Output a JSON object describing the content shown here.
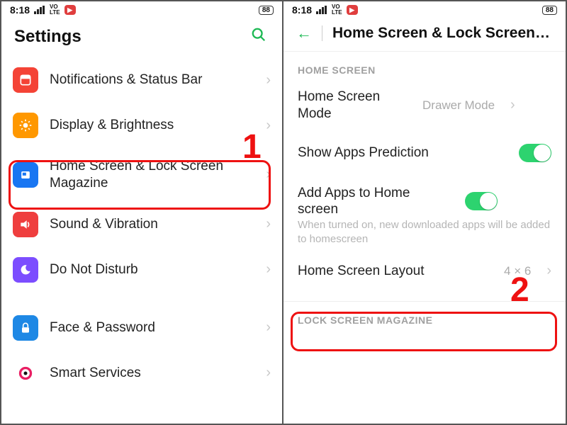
{
  "status": {
    "time": "8:18",
    "volte": "VO\nLTE",
    "battery": "88"
  },
  "left": {
    "title": "Settings",
    "items": [
      {
        "label": "Notifications & Status Bar"
      },
      {
        "label": "Display & Brightness"
      },
      {
        "label": "Home Screen & Lock Screen Magazine"
      },
      {
        "label": "Sound & Vibration"
      },
      {
        "label": "Do Not Disturb"
      },
      {
        "label": "Face & Password"
      },
      {
        "label": "Smart Services"
      }
    ]
  },
  "right": {
    "title": "Home Screen & Lock Screen…",
    "section1": "HOME SCREEN",
    "rows": {
      "mode_label": "Home Screen Mode",
      "mode_value": "Drawer Mode",
      "show_pred": "Show Apps Prediction",
      "add_apps": "Add Apps to Home screen",
      "add_apps_sub": "When turned on, new downloaded apps will be added to homescreen",
      "layout_label": "Home Screen Layout",
      "layout_value": "4 × 6"
    },
    "section2": "LOCK SCREEN MAGAZINE"
  },
  "callouts": {
    "one": "1",
    "two": "2"
  }
}
